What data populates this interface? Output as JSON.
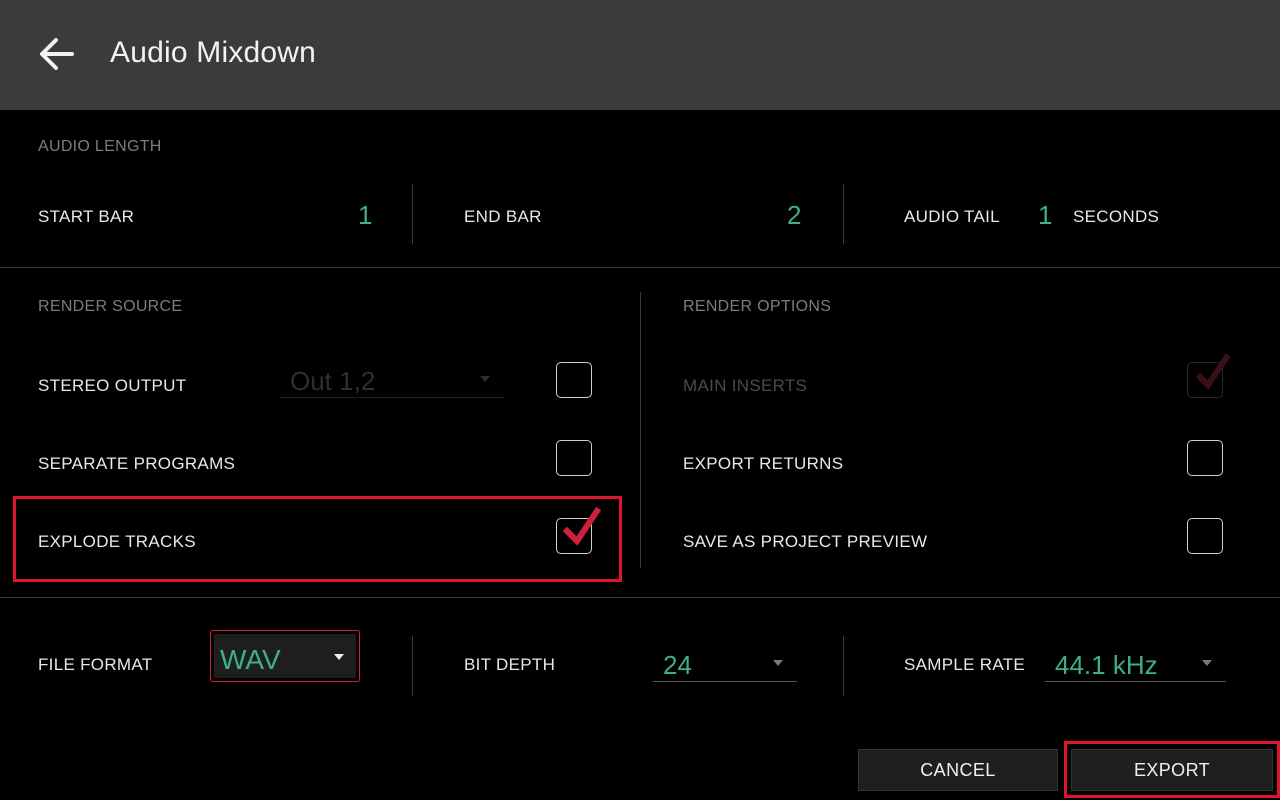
{
  "header": {
    "title": "Audio Mixdown",
    "back_icon": "arrow-left-icon"
  },
  "audio_length": {
    "section_label": "AUDIO LENGTH",
    "start_bar_label": "START BAR",
    "start_bar_value": "1",
    "end_bar_label": "END BAR",
    "end_bar_value": "2",
    "audio_tail_label": "AUDIO TAIL",
    "audio_tail_value": "1",
    "audio_tail_unit": "SECONDS"
  },
  "render_source": {
    "section_label": "RENDER SOURCE",
    "stereo_output_label": "STEREO OUTPUT",
    "stereo_output_value": "Out 1,2",
    "stereo_output_checked": false,
    "separate_programs_label": "SEPARATE PROGRAMS",
    "separate_programs_checked": false,
    "explode_tracks_label": "EXPLODE TRACKS",
    "explode_tracks_checked": true
  },
  "render_options": {
    "section_label": "RENDER OPTIONS",
    "main_inserts_label": "MAIN INSERTS",
    "main_inserts_checked": true,
    "main_inserts_enabled": false,
    "export_returns_label": "EXPORT RETURNS",
    "export_returns_checked": false,
    "save_as_preview_label": "SAVE AS PROJECT PREVIEW",
    "save_as_preview_checked": false
  },
  "format": {
    "file_format_label": "FILE FORMAT",
    "file_format_value": "WAV",
    "bit_depth_label": "BIT DEPTH",
    "bit_depth_value": "24",
    "sample_rate_label": "SAMPLE RATE",
    "sample_rate_value": "44.1 kHz"
  },
  "actions": {
    "cancel_label": "CANCEL",
    "export_label": "EXPORT"
  },
  "colors": {
    "accent_value": "#3fae8c",
    "check_mark": "#d0213c",
    "highlight": "#e0162e",
    "header_bg": "#3b3b3c"
  }
}
